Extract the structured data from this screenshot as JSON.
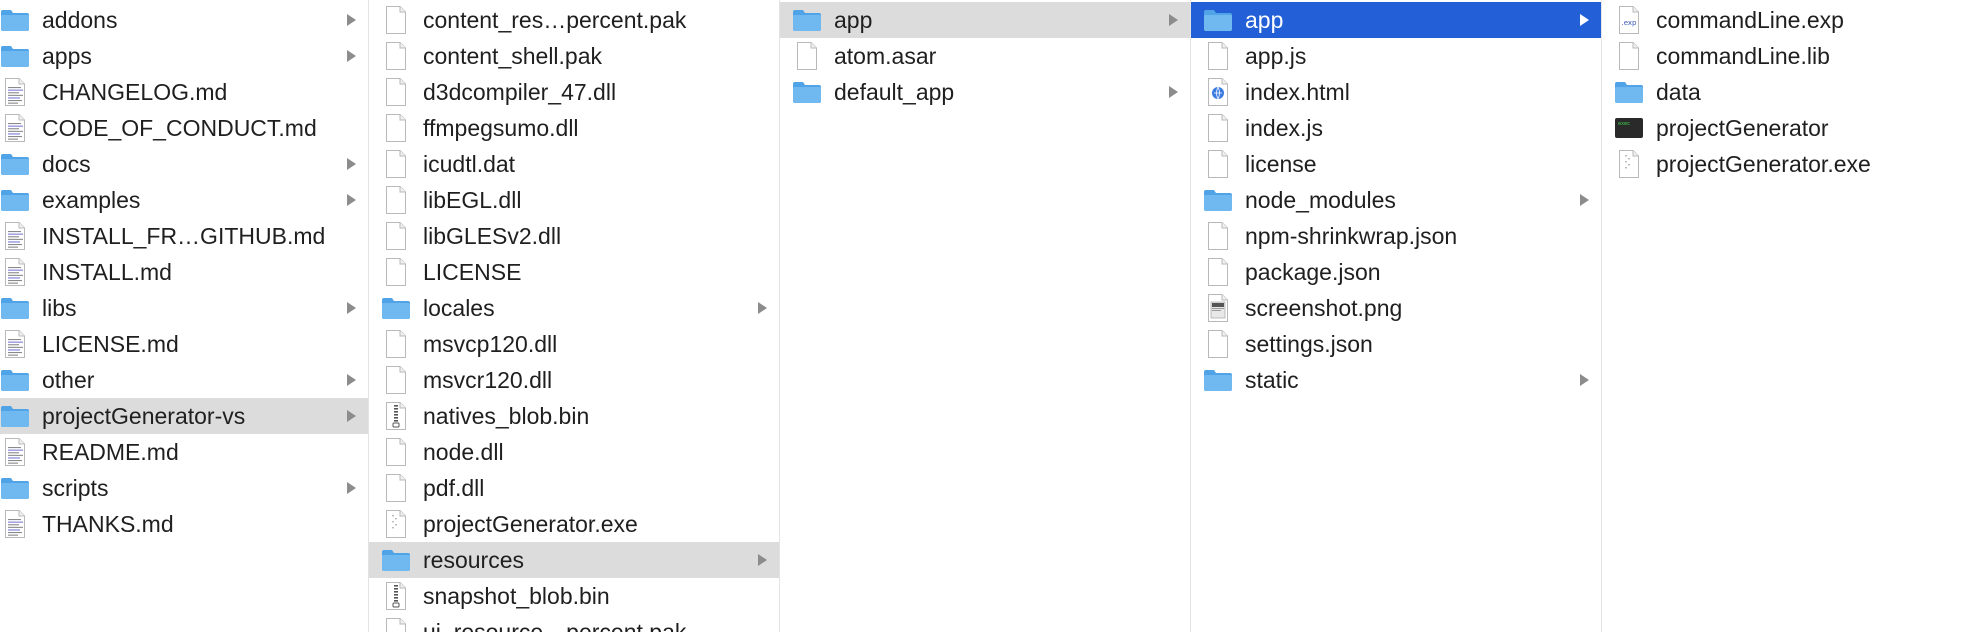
{
  "colors": {
    "folder": "#6fb8f0",
    "selection_active": "#2360d8",
    "selection_inactive": "#dcdcdc",
    "text": "#1f1f1f"
  },
  "columns": [
    {
      "items": [
        {
          "name": "addons",
          "kind": "folder",
          "arrow": true
        },
        {
          "name": "apps",
          "kind": "folder",
          "arrow": true
        },
        {
          "name": "CHANGELOG.md",
          "kind": "text"
        },
        {
          "name": "CODE_OF_CONDUCT.md",
          "kind": "text"
        },
        {
          "name": "docs",
          "kind": "folder",
          "arrow": true
        },
        {
          "name": "examples",
          "kind": "folder",
          "arrow": true
        },
        {
          "name": "INSTALL_FR…GITHUB.md",
          "kind": "text"
        },
        {
          "name": "INSTALL.md",
          "kind": "text"
        },
        {
          "name": "libs",
          "kind": "folder",
          "arrow": true
        },
        {
          "name": "LICENSE.md",
          "kind": "text"
        },
        {
          "name": "other",
          "kind": "folder",
          "arrow": true
        },
        {
          "name": "projectGenerator-vs",
          "kind": "folder",
          "arrow": true,
          "selected": "inactive"
        },
        {
          "name": "README.md",
          "kind": "text"
        },
        {
          "name": "scripts",
          "kind": "folder",
          "arrow": true
        },
        {
          "name": "THANKS.md",
          "kind": "text"
        }
      ]
    },
    {
      "items": [
        {
          "name": "content_res…percent.pak",
          "kind": "file"
        },
        {
          "name": "content_shell.pak",
          "kind": "file"
        },
        {
          "name": "d3dcompiler_47.dll",
          "kind": "file"
        },
        {
          "name": "ffmpegsumo.dll",
          "kind": "file"
        },
        {
          "name": "icudtl.dat",
          "kind": "file"
        },
        {
          "name": "libEGL.dll",
          "kind": "file"
        },
        {
          "name": "libGLESv2.dll",
          "kind": "file"
        },
        {
          "name": "LICENSE",
          "kind": "file"
        },
        {
          "name": "locales",
          "kind": "folder",
          "arrow": true
        },
        {
          "name": "msvcp120.dll",
          "kind": "file"
        },
        {
          "name": "msvcr120.dll",
          "kind": "file"
        },
        {
          "name": "natives_blob.bin",
          "kind": "archive"
        },
        {
          "name": "node.dll",
          "kind": "file"
        },
        {
          "name": "pdf.dll",
          "kind": "file"
        },
        {
          "name": "projectGenerator.exe",
          "kind": "exe"
        },
        {
          "name": "resources",
          "kind": "folder",
          "arrow": true,
          "selected": "inactive"
        },
        {
          "name": "snapshot_blob.bin",
          "kind": "archive"
        },
        {
          "name": "ui_resource…percent.pak",
          "kind": "file"
        }
      ]
    },
    {
      "items": [
        {
          "name": "app",
          "kind": "folder",
          "arrow": true,
          "selected": "inactive"
        },
        {
          "name": "atom.asar",
          "kind": "file"
        },
        {
          "name": "default_app",
          "kind": "folder",
          "arrow": true
        }
      ]
    },
    {
      "items": [
        {
          "name": "app",
          "kind": "folder",
          "arrow": true,
          "selected": "active"
        },
        {
          "name": "app.js",
          "kind": "file"
        },
        {
          "name": "index.html",
          "kind": "html"
        },
        {
          "name": "index.js",
          "kind": "file"
        },
        {
          "name": "license",
          "kind": "file"
        },
        {
          "name": "node_modules",
          "kind": "folder",
          "arrow": true
        },
        {
          "name": "npm-shrinkwrap.json",
          "kind": "file"
        },
        {
          "name": "package.json",
          "kind": "file"
        },
        {
          "name": "screenshot.png",
          "kind": "image"
        },
        {
          "name": "settings.json",
          "kind": "file"
        },
        {
          "name": "static",
          "kind": "folder",
          "arrow": true
        }
      ]
    },
    {
      "items": [
        {
          "name": "commandLine.exp",
          "kind": "exp",
          "badge": ".exp"
        },
        {
          "name": "commandLine.lib",
          "kind": "file"
        },
        {
          "name": "data",
          "kind": "folder"
        },
        {
          "name": "projectGenerator",
          "kind": "terminal",
          "badge": "exec"
        },
        {
          "name": "projectGenerator.exe",
          "kind": "exe"
        }
      ]
    }
  ]
}
